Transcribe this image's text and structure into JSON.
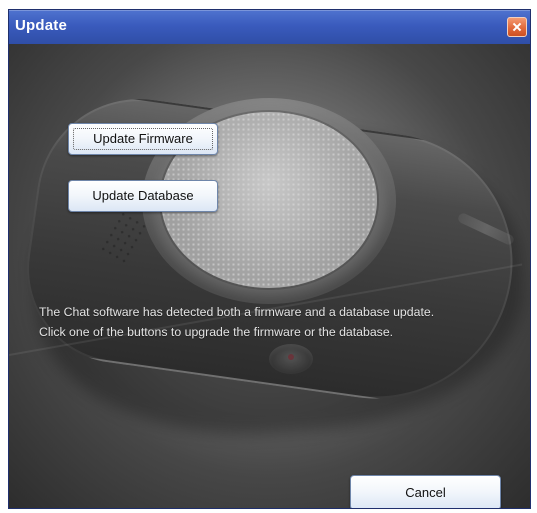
{
  "window": {
    "title": "Update"
  },
  "buttons": {
    "update_firmware": "Update Firmware",
    "update_database": "Update Database",
    "cancel": "Cancel"
  },
  "message": {
    "line1": "The Chat software has detected both a firmware and a database update.",
    "line2": "Click one of the buttons to upgrade the firmware or the database."
  },
  "icons": {
    "close": "close-icon",
    "background": "speaker-image"
  },
  "colors": {
    "title_bar": "#3a5bbd",
    "close_button": "#e26a3c",
    "button_face": "#f2f6fb",
    "button_border": "#6f86aa",
    "dialog_background": "#3b3b3b",
    "message_text": "#e3e3e3"
  }
}
